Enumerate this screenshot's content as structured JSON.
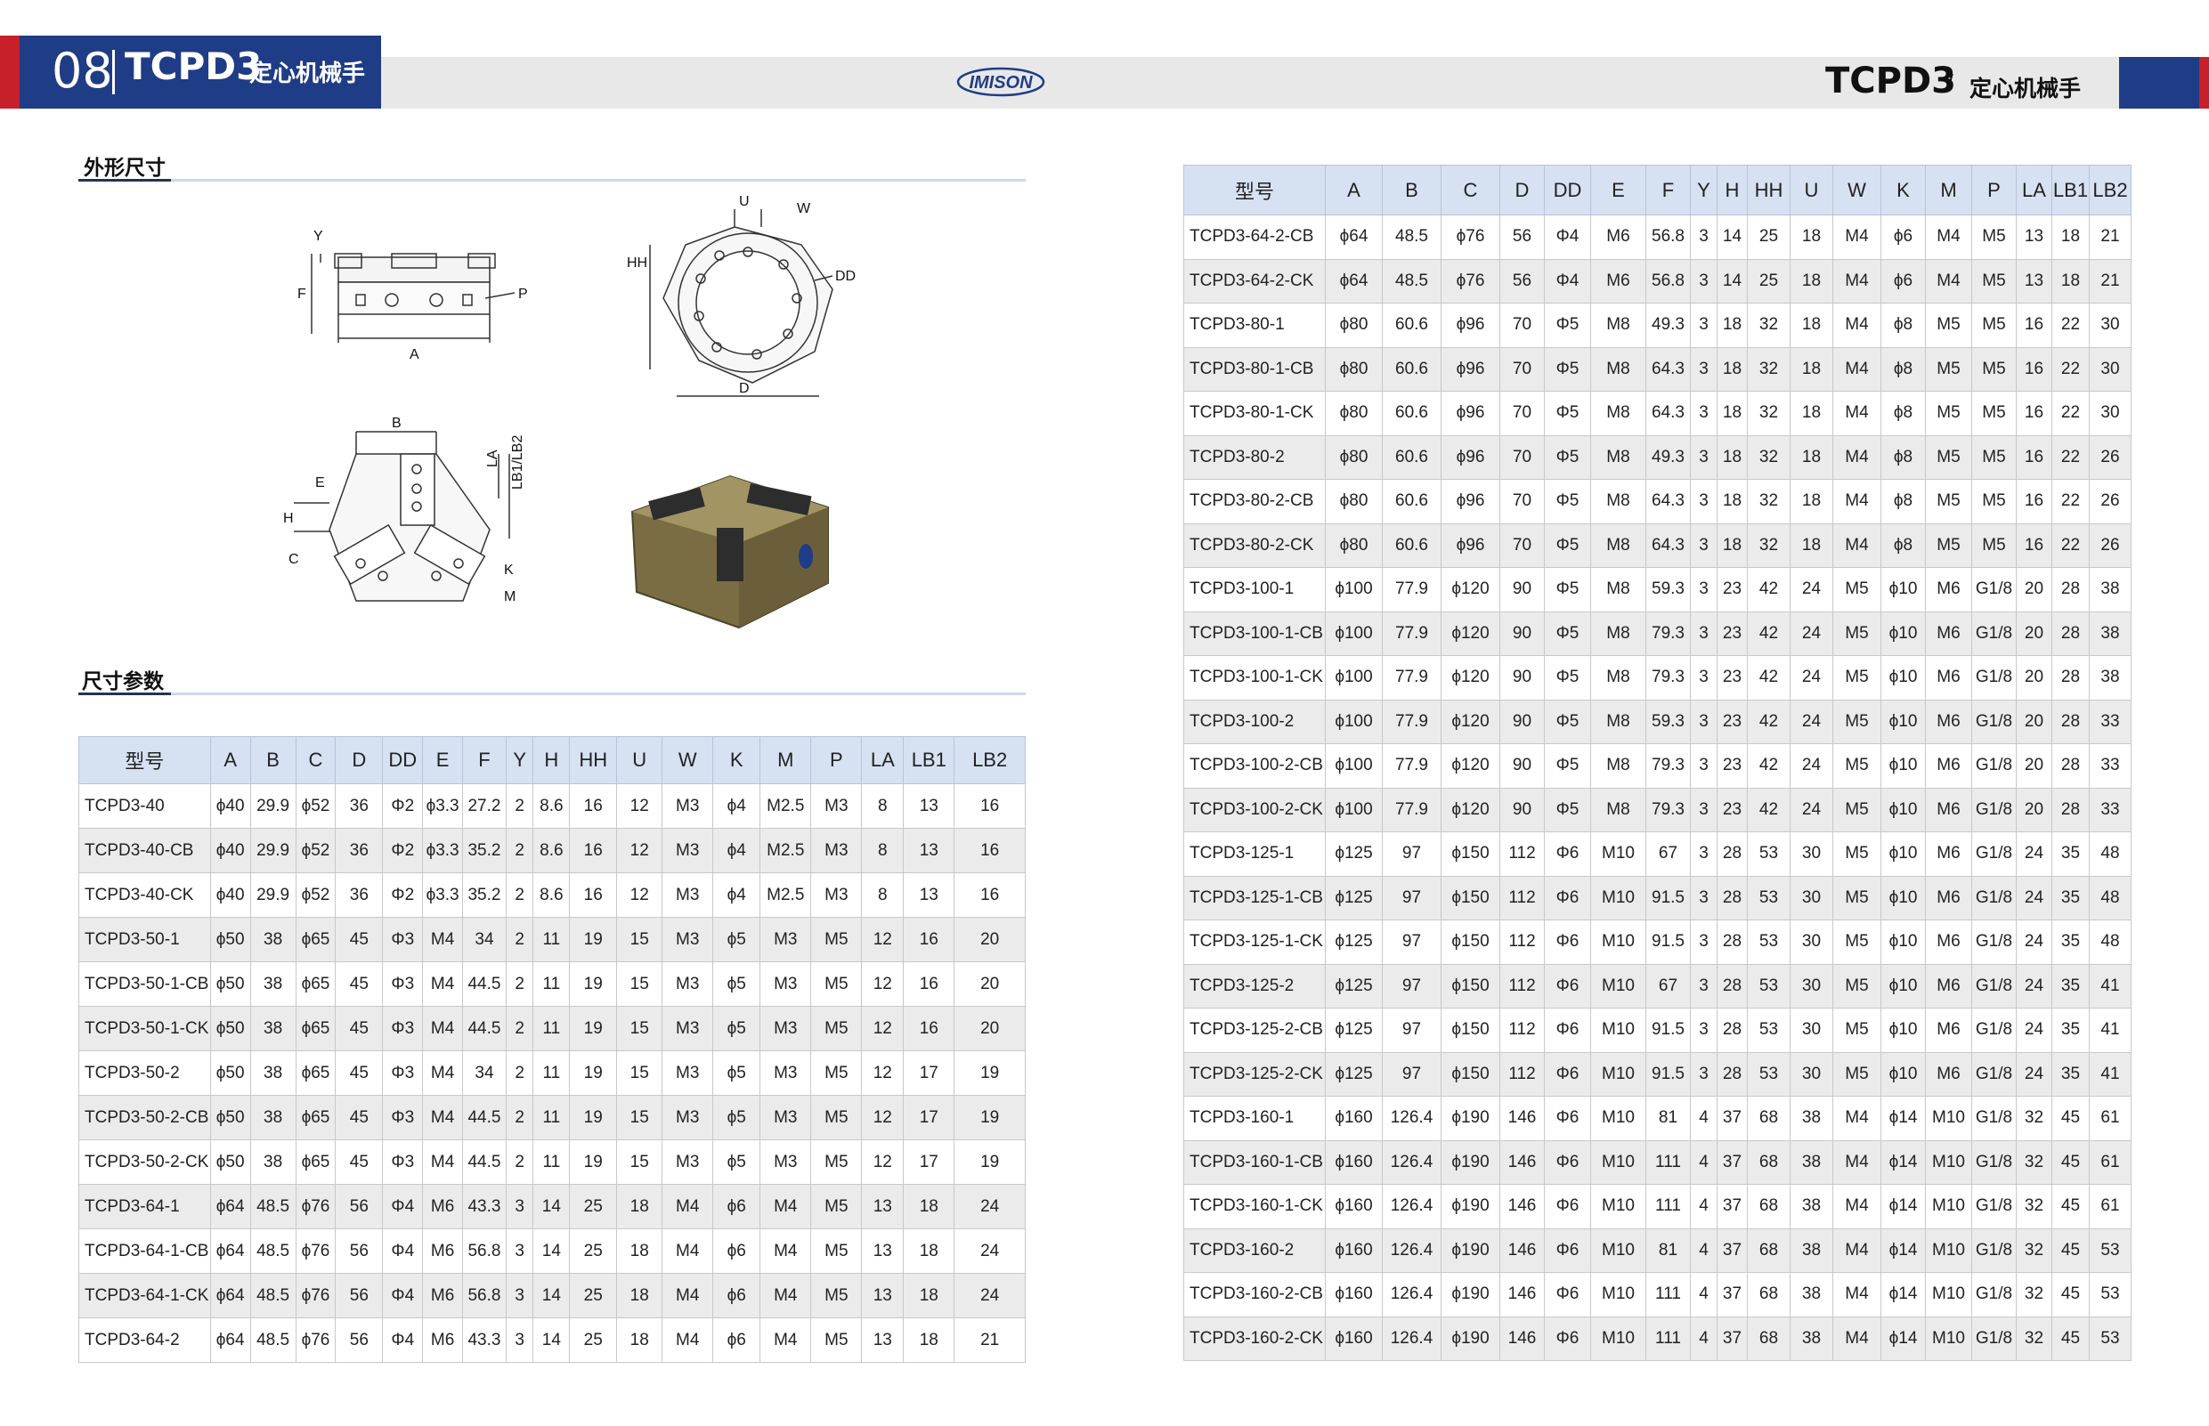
{
  "header": {
    "page_number": "08",
    "code": "TCPD3",
    "title_cn": "定心机械手",
    "logo_text": "IMISON",
    "right_code": "TCPD3",
    "right_slash": "/",
    "right_title_cn": "定心机械手"
  },
  "sections": {
    "outline_title": "外形尺寸",
    "params_title": "尺寸参数"
  },
  "drawing_labels": {
    "y": "Y",
    "f": "F",
    "p": "P",
    "a": "A",
    "u": "U",
    "w": "W",
    "hh": "HH",
    "dd": "DD",
    "d": "D",
    "b": "B",
    "la": "LA",
    "lb": "LB1/LB2",
    "e": "E",
    "h": "H",
    "c": "C",
    "k": "K",
    "m": "M"
  },
  "table_columns": [
    "型号",
    "A",
    "B",
    "C",
    "D",
    "DD",
    "E",
    "F",
    "Y",
    "H",
    "HH",
    "U",
    "W",
    "K",
    "M",
    "P",
    "LA",
    "LB1",
    "LB2"
  ],
  "left_table_rows": [
    [
      "TCPD3-40",
      "ϕ40",
      "29.9",
      "ϕ52",
      "36",
      "Φ2",
      "ϕ3.3",
      "27.2",
      "2",
      "8.6",
      "16",
      "12",
      "M3",
      "ϕ4",
      "M2.5",
      "M3",
      "8",
      "13",
      "16"
    ],
    [
      "TCPD3-40-CB",
      "ϕ40",
      "29.9",
      "ϕ52",
      "36",
      "Φ2",
      "ϕ3.3",
      "35.2",
      "2",
      "8.6",
      "16",
      "12",
      "M3",
      "ϕ4",
      "M2.5",
      "M3",
      "8",
      "13",
      "16"
    ],
    [
      "TCPD3-40-CK",
      "ϕ40",
      "29.9",
      "ϕ52",
      "36",
      "Φ2",
      "ϕ3.3",
      "35.2",
      "2",
      "8.6",
      "16",
      "12",
      "M3",
      "ϕ4",
      "M2.5",
      "M3",
      "8",
      "13",
      "16"
    ],
    [
      "TCPD3-50-1",
      "ϕ50",
      "38",
      "ϕ65",
      "45",
      "Φ3",
      "M4",
      "34",
      "2",
      "11",
      "19",
      "15",
      "M3",
      "ϕ5",
      "M3",
      "M5",
      "12",
      "16",
      "20"
    ],
    [
      "TCPD3-50-1-CB",
      "ϕ50",
      "38",
      "ϕ65",
      "45",
      "Φ3",
      "M4",
      "44.5",
      "2",
      "11",
      "19",
      "15",
      "M3",
      "ϕ5",
      "M3",
      "M5",
      "12",
      "16",
      "20"
    ],
    [
      "TCPD3-50-1-CK",
      "ϕ50",
      "38",
      "ϕ65",
      "45",
      "Φ3",
      "M4",
      "44.5",
      "2",
      "11",
      "19",
      "15",
      "M3",
      "ϕ5",
      "M3",
      "M5",
      "12",
      "16",
      "20"
    ],
    [
      "TCPD3-50-2",
      "ϕ50",
      "38",
      "ϕ65",
      "45",
      "Φ3",
      "M4",
      "34",
      "2",
      "11",
      "19",
      "15",
      "M3",
      "ϕ5",
      "M3",
      "M5",
      "12",
      "17",
      "19"
    ],
    [
      "TCPD3-50-2-CB",
      "ϕ50",
      "38",
      "ϕ65",
      "45",
      "Φ3",
      "M4",
      "44.5",
      "2",
      "11",
      "19",
      "15",
      "M3",
      "ϕ5",
      "M3",
      "M5",
      "12",
      "17",
      "19"
    ],
    [
      "TCPD3-50-2-CK",
      "ϕ50",
      "38",
      "ϕ65",
      "45",
      "Φ3",
      "M4",
      "44.5",
      "2",
      "11",
      "19",
      "15",
      "M3",
      "ϕ5",
      "M3",
      "M5",
      "12",
      "17",
      "19"
    ],
    [
      "TCPD3-64-1",
      "ϕ64",
      "48.5",
      "ϕ76",
      "56",
      "Φ4",
      "M6",
      "43.3",
      "3",
      "14",
      "25",
      "18",
      "M4",
      "ϕ6",
      "M4",
      "M5",
      "13",
      "18",
      "24"
    ],
    [
      "TCPD3-64-1-CB",
      "ϕ64",
      "48.5",
      "ϕ76",
      "56",
      "Φ4",
      "M6",
      "56.8",
      "3",
      "14",
      "25",
      "18",
      "M4",
      "ϕ6",
      "M4",
      "M5",
      "13",
      "18",
      "24"
    ],
    [
      "TCPD3-64-1-CK",
      "ϕ64",
      "48.5",
      "ϕ76",
      "56",
      "Φ4",
      "M6",
      "56.8",
      "3",
      "14",
      "25",
      "18",
      "M4",
      "ϕ6",
      "M4",
      "M5",
      "13",
      "18",
      "24"
    ],
    [
      "TCPD3-64-2",
      "ϕ64",
      "48.5",
      "ϕ76",
      "56",
      "Φ4",
      "M6",
      "43.3",
      "3",
      "14",
      "25",
      "18",
      "M4",
      "ϕ6",
      "M4",
      "M5",
      "13",
      "18",
      "21"
    ]
  ],
  "right_table_rows": [
    [
      "TCPD3-64-2-CB",
      "ϕ64",
      "48.5",
      "ϕ76",
      "56",
      "Φ4",
      "M6",
      "56.8",
      "3",
      "14",
      "25",
      "18",
      "M4",
      "ϕ6",
      "M4",
      "M5",
      "13",
      "18",
      "21"
    ],
    [
      "TCPD3-64-2-CK",
      "ϕ64",
      "48.5",
      "ϕ76",
      "56",
      "Φ4",
      "M6",
      "56.8",
      "3",
      "14",
      "25",
      "18",
      "M4",
      "ϕ6",
      "M4",
      "M5",
      "13",
      "18",
      "21"
    ],
    [
      "TCPD3-80-1",
      "ϕ80",
      "60.6",
      "ϕ96",
      "70",
      "Φ5",
      "M8",
      "49.3",
      "3",
      "18",
      "32",
      "18",
      "M4",
      "ϕ8",
      "M5",
      "M5",
      "16",
      "22",
      "30"
    ],
    [
      "TCPD3-80-1-CB",
      "ϕ80",
      "60.6",
      "ϕ96",
      "70",
      "Φ5",
      "M8",
      "64.3",
      "3",
      "18",
      "32",
      "18",
      "M4",
      "ϕ8",
      "M5",
      "M5",
      "16",
      "22",
      "30"
    ],
    [
      "TCPD3-80-1-CK",
      "ϕ80",
      "60.6",
      "ϕ96",
      "70",
      "Φ5",
      "M8",
      "64.3",
      "3",
      "18",
      "32",
      "18",
      "M4",
      "ϕ8",
      "M5",
      "M5",
      "16",
      "22",
      "30"
    ],
    [
      "TCPD3-80-2",
      "ϕ80",
      "60.6",
      "ϕ96",
      "70",
      "Φ5",
      "M8",
      "49.3",
      "3",
      "18",
      "32",
      "18",
      "M4",
      "ϕ8",
      "M5",
      "M5",
      "16",
      "22",
      "26"
    ],
    [
      "TCPD3-80-2-CB",
      "ϕ80",
      "60.6",
      "ϕ96",
      "70",
      "Φ5",
      "M8",
      "64.3",
      "3",
      "18",
      "32",
      "18",
      "M4",
      "ϕ8",
      "M5",
      "M5",
      "16",
      "22",
      "26"
    ],
    [
      "TCPD3-80-2-CK",
      "ϕ80",
      "60.6",
      "ϕ96",
      "70",
      "Φ5",
      "M8",
      "64.3",
      "3",
      "18",
      "32",
      "18",
      "M4",
      "ϕ8",
      "M5",
      "M5",
      "16",
      "22",
      "26"
    ],
    [
      "TCPD3-100-1",
      "ϕ100",
      "77.9",
      "ϕ120",
      "90",
      "Φ5",
      "M8",
      "59.3",
      "3",
      "23",
      "42",
      "24",
      "M5",
      "ϕ10",
      "M6",
      "G1/8",
      "20",
      "28",
      "38"
    ],
    [
      "TCPD3-100-1-CB",
      "ϕ100",
      "77.9",
      "ϕ120",
      "90",
      "Φ5",
      "M8",
      "79.3",
      "3",
      "23",
      "42",
      "24",
      "M5",
      "ϕ10",
      "M6",
      "G1/8",
      "20",
      "28",
      "38"
    ],
    [
      "TCPD3-100-1-CK",
      "ϕ100",
      "77.9",
      "ϕ120",
      "90",
      "Φ5",
      "M8",
      "79.3",
      "3",
      "23",
      "42",
      "24",
      "M5",
      "ϕ10",
      "M6",
      "G1/8",
      "20",
      "28",
      "38"
    ],
    [
      "TCPD3-100-2",
      "ϕ100",
      "77.9",
      "ϕ120",
      "90",
      "Φ5",
      "M8",
      "59.3",
      "3",
      "23",
      "42",
      "24",
      "M5",
      "ϕ10",
      "M6",
      "G1/8",
      "20",
      "28",
      "33"
    ],
    [
      "TCPD3-100-2-CB",
      "ϕ100",
      "77.9",
      "ϕ120",
      "90",
      "Φ5",
      "M8",
      "79.3",
      "3",
      "23",
      "42",
      "24",
      "M5",
      "ϕ10",
      "M6",
      "G1/8",
      "20",
      "28",
      "33"
    ],
    [
      "TCPD3-100-2-CK",
      "ϕ100",
      "77.9",
      "ϕ120",
      "90",
      "Φ5",
      "M8",
      "79.3",
      "3",
      "23",
      "42",
      "24",
      "M5",
      "ϕ10",
      "M6",
      "G1/8",
      "20",
      "28",
      "33"
    ],
    [
      "TCPD3-125-1",
      "ϕ125",
      "97",
      "ϕ150",
      "112",
      "Φ6",
      "M10",
      "67",
      "3",
      "28",
      "53",
      "30",
      "M5",
      "ϕ10",
      "M6",
      "G1/8",
      "24",
      "35",
      "48"
    ],
    [
      "TCPD3-125-1-CB",
      "ϕ125",
      "97",
      "ϕ150",
      "112",
      "Φ6",
      "M10",
      "91.5",
      "3",
      "28",
      "53",
      "30",
      "M5",
      "ϕ10",
      "M6",
      "G1/8",
      "24",
      "35",
      "48"
    ],
    [
      "TCPD3-125-1-CK",
      "ϕ125",
      "97",
      "ϕ150",
      "112",
      "Φ6",
      "M10",
      "91.5",
      "3",
      "28",
      "53",
      "30",
      "M5",
      "ϕ10",
      "M6",
      "G1/8",
      "24",
      "35",
      "48"
    ],
    [
      "TCPD3-125-2",
      "ϕ125",
      "97",
      "ϕ150",
      "112",
      "Φ6",
      "M10",
      "67",
      "3",
      "28",
      "53",
      "30",
      "M5",
      "ϕ10",
      "M6",
      "G1/8",
      "24",
      "35",
      "41"
    ],
    [
      "TCPD3-125-2-CB",
      "ϕ125",
      "97",
      "ϕ150",
      "112",
      "Φ6",
      "M10",
      "91.5",
      "3",
      "28",
      "53",
      "30",
      "M5",
      "ϕ10",
      "M6",
      "G1/8",
      "24",
      "35",
      "41"
    ],
    [
      "TCPD3-125-2-CK",
      "ϕ125",
      "97",
      "ϕ150",
      "112",
      "Φ6",
      "M10",
      "91.5",
      "3",
      "28",
      "53",
      "30",
      "M5",
      "ϕ10",
      "M6",
      "G1/8",
      "24",
      "35",
      "41"
    ],
    [
      "TCPD3-160-1",
      "ϕ160",
      "126.4",
      "ϕ190",
      "146",
      "Φ6",
      "M10",
      "81",
      "4",
      "37",
      "68",
      "38",
      "M4",
      "ϕ14",
      "M10",
      "G1/8",
      "32",
      "45",
      "61"
    ],
    [
      "TCPD3-160-1-CB",
      "ϕ160",
      "126.4",
      "ϕ190",
      "146",
      "Φ6",
      "M10",
      "111",
      "4",
      "37",
      "68",
      "38",
      "M4",
      "ϕ14",
      "M10",
      "G1/8",
      "32",
      "45",
      "61"
    ],
    [
      "TCPD3-160-1-CK",
      "ϕ160",
      "126.4",
      "ϕ190",
      "146",
      "Φ6",
      "M10",
      "111",
      "4",
      "37",
      "68",
      "38",
      "M4",
      "ϕ14",
      "M10",
      "G1/8",
      "32",
      "45",
      "61"
    ],
    [
      "TCPD3-160-2",
      "ϕ160",
      "126.4",
      "ϕ190",
      "146",
      "Φ6",
      "M10",
      "81",
      "4",
      "37",
      "68",
      "38",
      "M4",
      "ϕ14",
      "M10",
      "G1/8",
      "32",
      "45",
      "53"
    ],
    [
      "TCPD3-160-2-CB",
      "ϕ160",
      "126.4",
      "ϕ190",
      "146",
      "Φ6",
      "M10",
      "111",
      "4",
      "37",
      "68",
      "38",
      "M4",
      "ϕ14",
      "M10",
      "G1/8",
      "32",
      "45",
      "53"
    ],
    [
      "TCPD3-160-2-CK",
      "ϕ160",
      "126.4",
      "ϕ190",
      "146",
      "Φ6",
      "M10",
      "111",
      "4",
      "37",
      "68",
      "38",
      "M4",
      "ϕ14",
      "M10",
      "G1/8",
      "32",
      "45",
      "53"
    ]
  ]
}
